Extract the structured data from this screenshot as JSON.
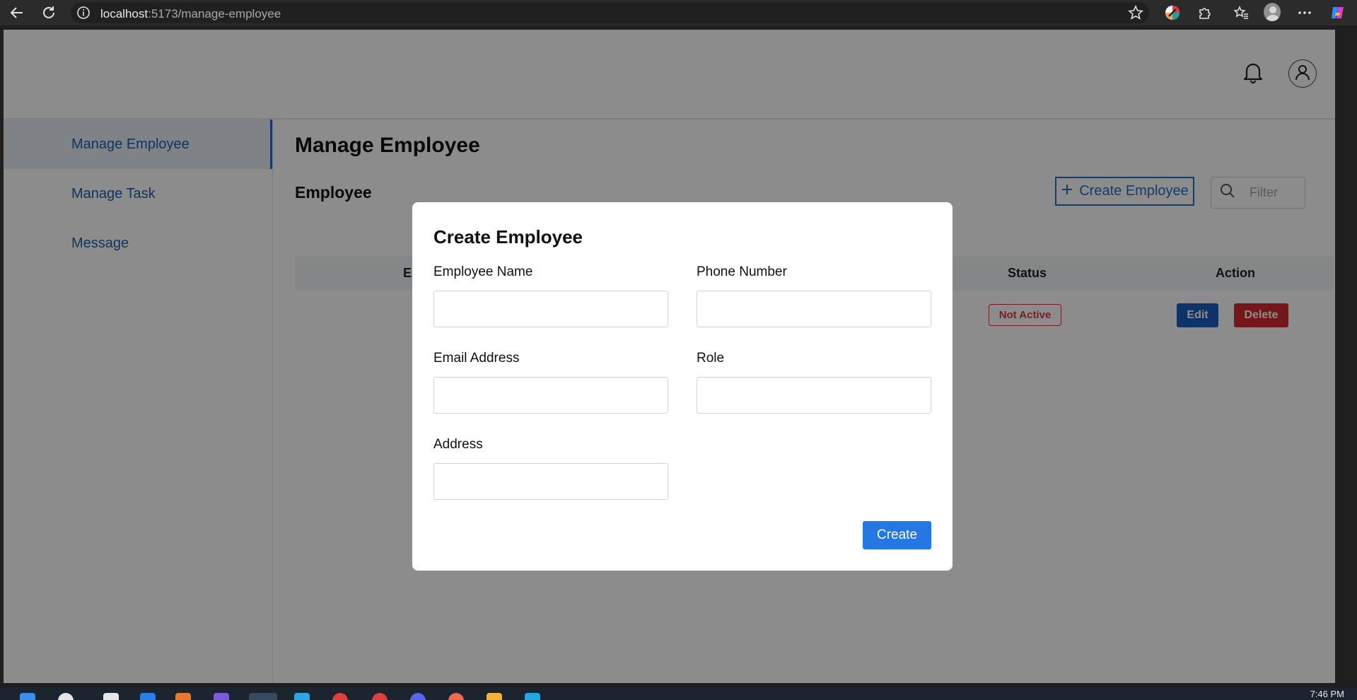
{
  "browser": {
    "url_host": "localhost",
    "url_path": ":5173/manage-employee",
    "icons": [
      "back-arrow-icon",
      "reload-icon",
      "site-info-icon",
      "favorite-star-icon",
      "color-extension-icon",
      "extensions-puzzle-icon",
      "favorites-icon",
      "profile-icon",
      "more-icon",
      "copilot-icon"
    ]
  },
  "header": {
    "icons": [
      "bell-icon",
      "user-icon"
    ]
  },
  "sidebar": {
    "items": [
      {
        "label": "Manage Employee",
        "active": true
      },
      {
        "label": "Manage Task",
        "active": false
      },
      {
        "label": "Message",
        "active": false
      }
    ]
  },
  "main": {
    "page_title": "Manage Employee",
    "section_title": "Employee",
    "create_button_label": "Create Employee",
    "create_button_icon": "plus-icon",
    "filter_placeholder": "Filter",
    "filter_icon": "search-icon",
    "table": {
      "headers": [
        "E",
        "Status",
        "Action"
      ],
      "rows": [
        {
          "status": "Not Active",
          "edit_label": "Edit",
          "delete_label": "Delete"
        }
      ]
    }
  },
  "modal": {
    "title": "Create Employee",
    "fields": [
      {
        "label": "Employee Name",
        "value": ""
      },
      {
        "label": "Phone Number",
        "value": ""
      },
      {
        "label": "Email Address",
        "value": ""
      },
      {
        "label": "Role",
        "value": ""
      },
      {
        "label": "Address",
        "value": ""
      }
    ],
    "submit_label": "Create"
  },
  "taskbar": {
    "clock": "7:46 PM"
  },
  "colors": {
    "primary": "#2d6bc4",
    "danger": "#d12b32",
    "submit": "#2577e2",
    "overlay": "rgba(0,0,0,0.45)"
  }
}
